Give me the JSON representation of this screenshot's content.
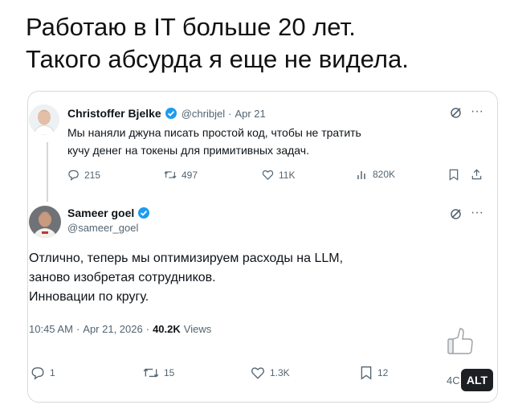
{
  "caption": {
    "line1": "Работаю в IT больше 20 лет.",
    "line2": "Такого абсурда я еще не видела."
  },
  "quoted_tweet": {
    "author_name": "Christoffer Bjelke",
    "handle": "@chribjel",
    "separator": "·",
    "date": "Apr 21",
    "text_line1": "Мы наняли джуна писать простой код, чтобы не тратить",
    "text_line2": "кучу денег на токены для примитивных задач.",
    "replies": "215",
    "reposts": "497",
    "likes": "11K",
    "views": "820K"
  },
  "main_tweet": {
    "author_name": "Sameer goel",
    "handle": "@sameer_goel",
    "text_line1": "Отлично, теперь мы оптимизируем расходы на LLM,",
    "text_line2": "заново изобретая сотрудников.",
    "text_line3": "Инновации по кругу.",
    "time": "10:45 AM",
    "separator": "·",
    "date": "Apr 21, 2026",
    "separator2": "·",
    "views_count": "40.2K",
    "views_label": "Views",
    "replies": "1",
    "reposts": "15",
    "likes": "1.3K",
    "bookmarks": "12",
    "truncated_count": "4C"
  },
  "alt_button": {
    "label": "ALT"
  },
  "colors": {
    "verified": "#1d9bf0",
    "muted": "#536471",
    "border": "#d6dadd"
  }
}
